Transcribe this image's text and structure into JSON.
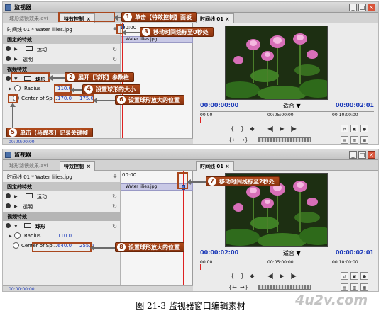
{
  "window": {
    "title": "监视器",
    "min": "_",
    "max": "□",
    "close": "×"
  },
  "top": {
    "tabs": [
      "球形滤镜效果.avi",
      "特效控制",
      "×"
    ],
    "seq_label": "时间线 01 * Water lilies.jpg",
    "seq_time": "00:00",
    "clip_name": "Water lilies.jpg",
    "fixed_fx": "固定的特效",
    "motion": "运动",
    "opacity": "透明",
    "video_fx": "视频特效",
    "sphere": "球形",
    "radius_label": "Radius",
    "radius_value": "110.0",
    "center_label": "Center of Sp...",
    "center_x": "170.0",
    "center_y": "175.0",
    "bottom_tc": "00:00:00:00",
    "monitor_tab": "时间线 01",
    "monitor_close": "×",
    "tc_left": "00:00:00:00",
    "fit": "适合",
    "tc_right": "00:00:02:01",
    "ruler": [
      "00:00",
      "00:05:00:00",
      "00:10:00:00"
    ]
  },
  "bottom": {
    "tabs": [
      "球形滤镜效果.avi",
      "特效控制",
      "×"
    ],
    "seq_label": "时间线 01 * Water lilies.jpg",
    "seq_time": "00:00",
    "clip_name": "Water lilies.jpg",
    "fixed_fx": "固定的特效",
    "motion": "运动",
    "opacity": "透明",
    "video_fx": "视频特效",
    "sphere": "球形",
    "radius_label": "Radius",
    "radius_value": "110.0",
    "center_label": "Center of Sp...",
    "center_x": "640.0",
    "center_y": "255.0",
    "bottom_tc": "00:00:00:00",
    "monitor_tab": "时间线 01",
    "monitor_close": "×",
    "tc_left": "00:00:02:00",
    "fit": "适合",
    "tc_right": "00:00:02:01",
    "ruler": [
      "00:00",
      "00:05:00:00",
      "00:10:00:00"
    ]
  },
  "callouts": {
    "c1": {
      "num": "1",
      "text": "单击【特效控制】面板"
    },
    "c2": {
      "num": "2",
      "text": "展开【球形】参数栏"
    },
    "c3": {
      "num": "3",
      "text": "移动时间线标至0秒处"
    },
    "c4": {
      "num": "4",
      "text": "设置球形的大小"
    },
    "c5": {
      "num": "5",
      "text": "单击【马蹄表】记录关键帧"
    },
    "c6": {
      "num": "6",
      "text": "设置球形放大的位置"
    },
    "c7": {
      "num": "7",
      "text": "移动时间线标至2秒处"
    },
    "c8": {
      "num": "8",
      "text": "设置球形放大的位置"
    }
  },
  "caption": "图 21-3   监视器窗口编辑素材",
  "watermark": "4u2v.com",
  "colors": {
    "accent": "#8a3410",
    "timecode": "#1b39b8",
    "playhead": "#d22222"
  },
  "icons": [
    "monitor-icon",
    "eye-icon",
    "stopwatch-icon",
    "reset-icon",
    "play-icon",
    "lotus-image"
  ]
}
